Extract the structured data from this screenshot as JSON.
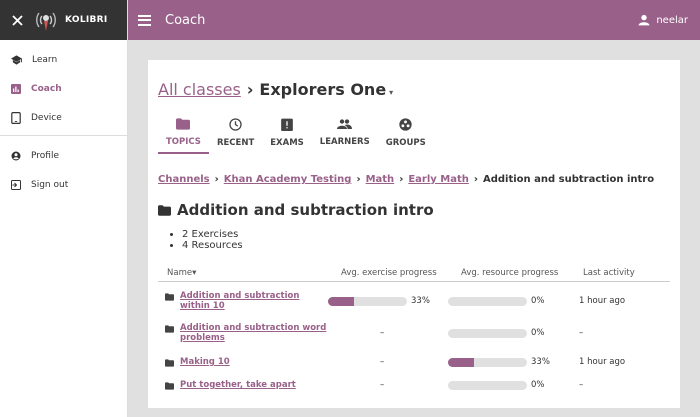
{
  "app": {
    "brand": "KOLIBRI",
    "page_title": "Coach",
    "username": "neelar"
  },
  "sidebar": {
    "items": [
      {
        "label": "Learn",
        "icon": "school-icon",
        "active": false
      },
      {
        "label": "Coach",
        "icon": "coach-icon",
        "active": true
      },
      {
        "label": "Device",
        "icon": "device-icon",
        "active": false
      }
    ],
    "account_items": [
      {
        "label": "Profile",
        "icon": "profile-icon"
      },
      {
        "label": "Sign out",
        "icon": "signout-icon"
      }
    ]
  },
  "header": {
    "all_classes": "All classes",
    "separator": "›",
    "class_name": "Explorers One"
  },
  "tabs": [
    {
      "label": "TOPICS",
      "icon": "folder-icon",
      "active": true
    },
    {
      "label": "RECENT",
      "icon": "clock-icon",
      "active": false
    },
    {
      "label": "EXAMS",
      "icon": "exam-icon",
      "active": false
    },
    {
      "label": "LEARNERS",
      "icon": "people-icon",
      "active": false
    },
    {
      "label": "GROUPS",
      "icon": "groups-icon",
      "active": false
    }
  ],
  "breadcrumbs": {
    "links": [
      "Channels",
      "Khan Academy Testing",
      "Math",
      "Early Math"
    ],
    "current": "Addition and subtraction intro"
  },
  "topic": {
    "title": "Addition and subtraction intro",
    "exercises": "2 Exercises",
    "resources": "4 Resources"
  },
  "table": {
    "headers": {
      "name": "Name",
      "exercise": "Avg. exercise progress",
      "resource": "Avg. resource progress",
      "activity": "Last activity"
    },
    "rows": [
      {
        "name": "Addition and subtraction within 10",
        "exercise_progress": 0.33,
        "exercise_label": "33%",
        "resource_progress": 0.0,
        "resource_label": "0%",
        "activity": "1 hour ago"
      },
      {
        "name": "Addition and subtraction word problems",
        "exercise_progress": null,
        "exercise_label": "–",
        "resource_progress": 0.0,
        "resource_label": "0%",
        "activity": "–"
      },
      {
        "name": "Making 10",
        "exercise_progress": null,
        "exercise_label": "–",
        "resource_progress": 0.33,
        "resource_label": "33%",
        "activity": "1 hour ago"
      },
      {
        "name": "Put together, take apart",
        "exercise_progress": null,
        "exercise_label": "–",
        "resource_progress": 0.0,
        "resource_label": "0%",
        "activity": "–"
      }
    ]
  },
  "colors": {
    "brand": "#996189",
    "nav_dark": "#333333",
    "track": "#e0e0e0"
  }
}
